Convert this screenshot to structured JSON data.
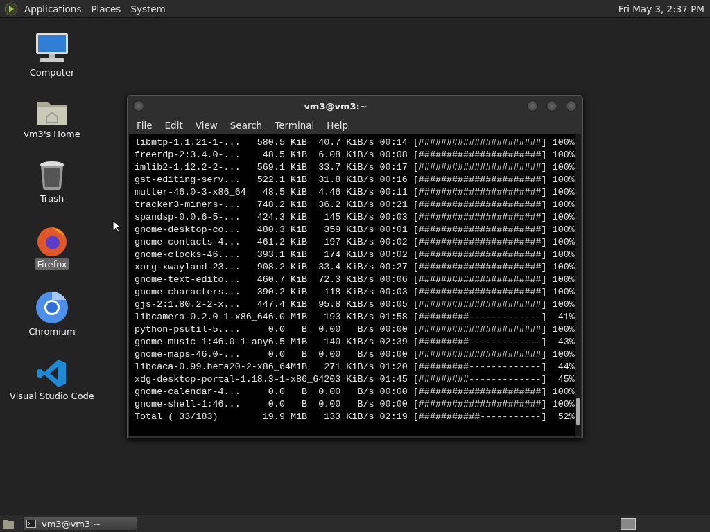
{
  "top_panel": {
    "menus": [
      "Applications",
      "Places",
      "System"
    ],
    "clock": "Fri May 3, 2:37 PM"
  },
  "desktop_icons": [
    {
      "kind": "computer",
      "label": "Computer",
      "selected": false
    },
    {
      "kind": "home",
      "label": "vm3's Home",
      "selected": false
    },
    {
      "kind": "trash",
      "label": "Trash",
      "selected": false
    },
    {
      "kind": "firefox",
      "label": "Firefox",
      "selected": true
    },
    {
      "kind": "chromium",
      "label": "Chromium",
      "selected": false
    },
    {
      "kind": "vscode",
      "label": "Visual Studio Code",
      "selected": false
    }
  ],
  "terminal": {
    "title": "vm3@vm3:~",
    "menus": [
      "File",
      "Edit",
      "View",
      "Search",
      "Terminal",
      "Help"
    ],
    "lines": [
      "libmtp-1.1.21-1-...   580.5 KiB  40.7 KiB/s 00:14 [######################] 100%",
      "freerdp-2:3.4.0-...    48.5 KiB  6.08 KiB/s 00:08 [######################] 100%",
      "imlib2-1.12.2-2-...   569.1 KiB  33.7 KiB/s 00:17 [######################] 100%",
      "gst-editing-serv...   522.1 KiB  31.8 KiB/s 00:16 [######################] 100%",
      "mutter-46.0-3-x86_64   48.5 KiB  4.46 KiB/s 00:11 [######################] 100%",
      "tracker3-miners-...   748.2 KiB  36.2 KiB/s 00:21 [######################] 100%",
      "spandsp-0.0.6-5-...   424.3 KiB   145 KiB/s 00:03 [######################] 100%",
      "gnome-desktop-co...   480.3 KiB   359 KiB/s 00:01 [######################] 100%",
      "gnome-contacts-4...   461.2 KiB   197 KiB/s 00:02 [######################] 100%",
      "gnome-clocks-46....   393.1 KiB   174 KiB/s 00:02 [######################] 100%",
      "xorg-xwayland-23...   908.2 KiB  33.4 KiB/s 00:27 [######################] 100%",
      "gnome-text-edito...   460.7 KiB  72.3 KiB/s 00:06 [######################] 100%",
      "gnome-characters...   390.2 KiB   118 KiB/s 00:03 [######################] 100%",
      "gjs-2:1.80.2-2-x...   447.4 KiB  95.8 KiB/s 00:05 [######################] 100%",
      "libcamera-0.2.0-1-x86_646.0 MiB   193 KiB/s 01:58 [#########-------------]  41%",
      "python-psutil-5....     0.0   B  0.00   B/s 00:00 [######################] 100%",
      "gnome-music-1:46.0-1-any6.5 MiB   140 KiB/s 02:39 [#########-------------]  43%",
      "gnome-maps-46.0-...     0.0   B  0.00   B/s 00:00 [######################] 100%",
      "libcaca-0.99.beta20-2-x86_64MiB   271 KiB/s 01:20 [#########-------------]  44%",
      "xdg-desktop-portal-1.18.3-1-x86_64203 KiB/s 01:45 [#########-------------]  45%",
      "gnome-calendar-4...     0.0   B  0.00   B/s 00:00 [######################] 100%",
      "gnome-shell-1:46...     0.0   B  0.00   B/s 00:00 [######################] 100%",
      "Total ( 33/183)        19.9 MiB   133 KiB/s 02:19 [###########-----------]  52%"
    ]
  },
  "taskbar": {
    "tasks": [
      {
        "label": "vm3@vm3:~",
        "selected": true
      }
    ]
  }
}
